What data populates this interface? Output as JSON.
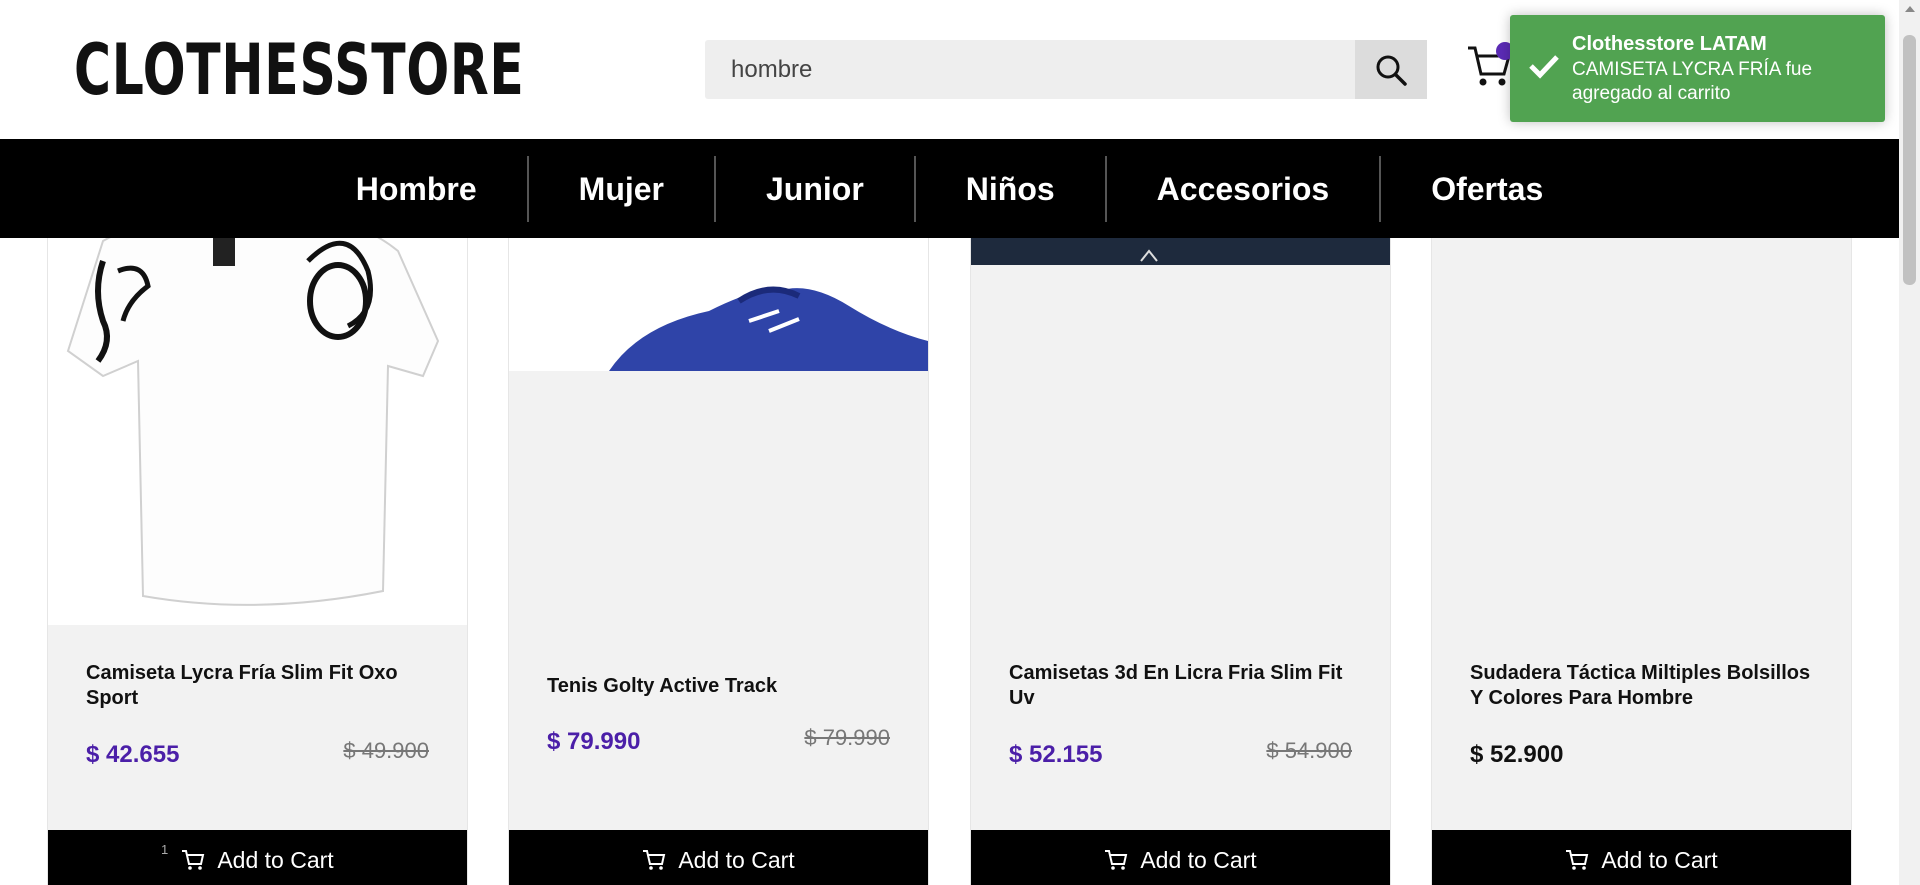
{
  "header": {
    "logo": "CLOTHESSTORE",
    "search": {
      "value": "hombre",
      "placeholder": ""
    }
  },
  "nav": {
    "items": [
      {
        "label": "Hombre"
      },
      {
        "label": "Mujer"
      },
      {
        "label": "Junior"
      },
      {
        "label": "Niños"
      },
      {
        "label": "Accesorios"
      },
      {
        "label": "Ofertas"
      }
    ]
  },
  "products": [
    {
      "name": "Camiseta Lycra Fría Slim Fit Oxo Sport",
      "price": "$ 42.655",
      "old_price": "$ 49.900",
      "button": "Add to Cart",
      "cart_qty": "1"
    },
    {
      "name": "Tenis Golty Active Track",
      "price": "$ 79.990",
      "old_price": "$ 79.990",
      "button": "Add to Cart"
    },
    {
      "name": "Camisetas 3d En Licra Fria Slim Fit Uv",
      "price": "$ 52.155",
      "old_price": "$ 54.900",
      "button": "Add to Cart"
    },
    {
      "name": "Sudadera Táctica Miltiples Bolsillos Y Colores Para Hombre",
      "price": "$ 52.900",
      "button": "Add to Cart"
    }
  ],
  "toast": {
    "title": "Clothesstore LATAM",
    "message": "CAMISETA LYCRA FRÍA fue agregado al carrito"
  },
  "colors": {
    "accent": "#4b1fa8",
    "toast_green": "#51a351",
    "nav_bg": "#000000"
  }
}
